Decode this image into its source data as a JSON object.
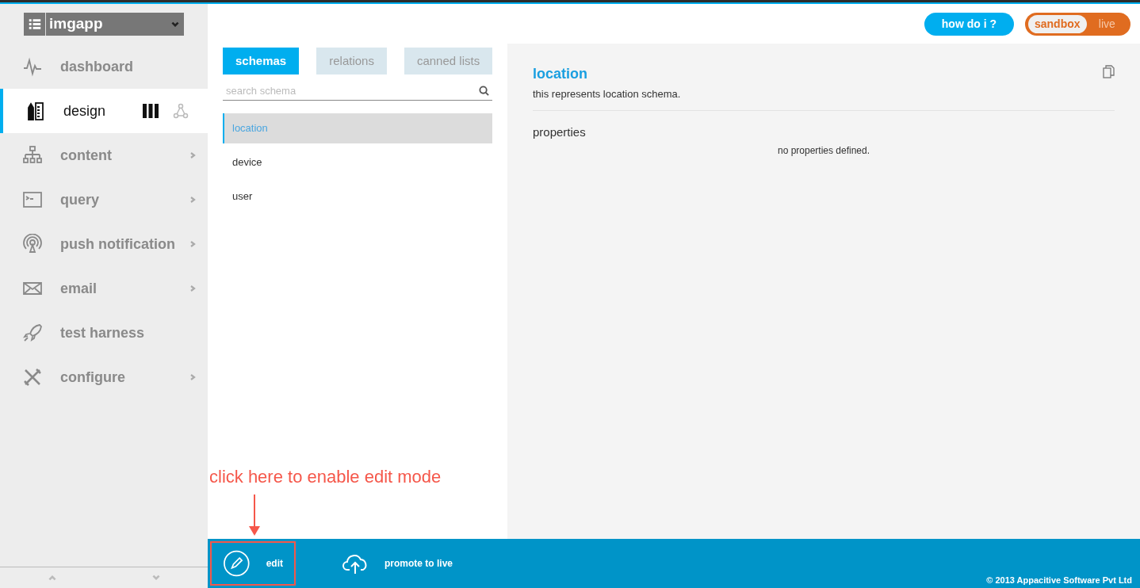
{
  "app_selector": {
    "value": "imgapp"
  },
  "sidebar": {
    "items": [
      {
        "label": "dashboard",
        "selected": false,
        "submenu": false
      },
      {
        "label": "design",
        "selected": true,
        "submenu": false,
        "views": [
          {
            "selected": true
          },
          {
            "selected": false
          }
        ]
      },
      {
        "label": "content",
        "selected": false,
        "submenu": true
      },
      {
        "label": "query",
        "selected": false,
        "submenu": true
      },
      {
        "label": "push notification",
        "selected": false,
        "submenu": true
      },
      {
        "label": "email",
        "selected": false,
        "submenu": true
      },
      {
        "label": "test harness",
        "selected": false,
        "submenu": false
      },
      {
        "label": "configure",
        "selected": false,
        "submenu": true
      }
    ]
  },
  "header": {
    "help_button": "how do i ?",
    "environment": [
      {
        "label": "sandbox",
        "selected": true
      },
      {
        "label": "live",
        "selected": false
      }
    ]
  },
  "tabs": [
    {
      "label": "schemas",
      "selected": true
    },
    {
      "label": "relations",
      "selected": false
    },
    {
      "label": "canned lists",
      "selected": false
    }
  ],
  "search": {
    "placeholder": "search schema"
  },
  "schemas": [
    {
      "label": "location",
      "selected": true
    },
    {
      "label": "device",
      "selected": false
    },
    {
      "label": "user",
      "selected": false
    }
  ],
  "detail": {
    "title": "location",
    "description": "this represents location schema.",
    "section": "properties",
    "empty_message": "no properties defined."
  },
  "annotation": {
    "text": "click here to enable edit mode"
  },
  "footer": {
    "actions": [
      {
        "label": "edit",
        "highlighted": true
      },
      {
        "label": "promote to live",
        "highlighted": false
      }
    ],
    "copyright": "© 2013 Appacitive Software Pvt Ltd"
  }
}
